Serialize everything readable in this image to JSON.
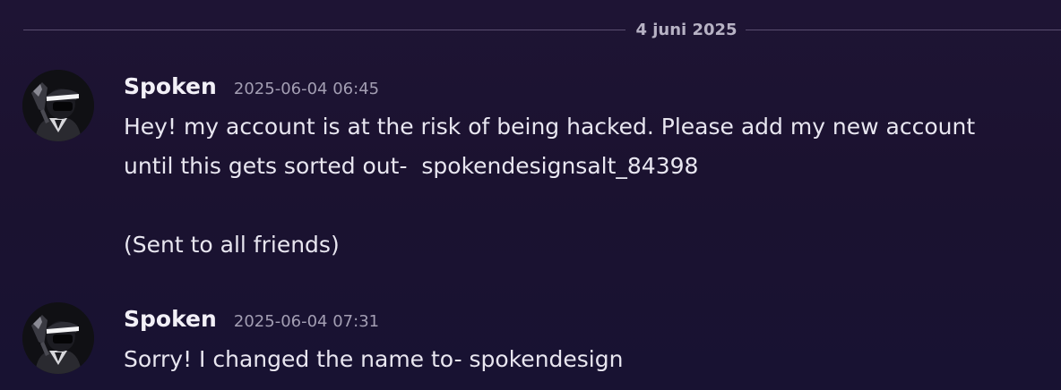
{
  "divider": {
    "date": "4 juni 2025"
  },
  "messages": [
    {
      "username": "Spoken",
      "timestamp": "2025-06-04 06:45",
      "lines": [
        "Hey! my account is at the risk of being hacked. Please add my new account",
        "until this gets sorted out-  spokendesignsalt_84398",
        "",
        "(Sent to all friends)"
      ]
    },
    {
      "username": "Spoken",
      "timestamp": "2025-06-04 07:31",
      "lines": [
        "Sorry! I changed the name to- spokendesign"
      ]
    }
  ],
  "colors": {
    "background": "#1b1230",
    "divider_line": "#5a4f70",
    "date_text": "#b7b2c4",
    "username": "#f2f0f7",
    "timestamp": "#a39eb3",
    "message_text": "#e8e6f0"
  },
  "icons": {
    "avatar": "masked-figure-avatar"
  }
}
